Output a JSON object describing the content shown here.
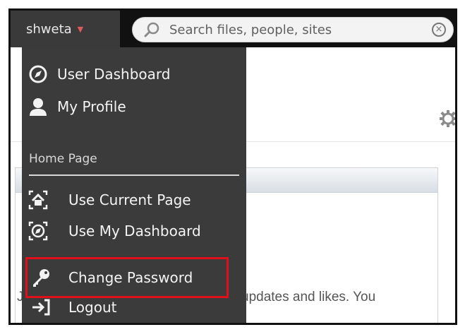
{
  "header": {
    "username": "shweta",
    "search": {
      "placeholder": "Search files, people, sites"
    }
  },
  "user_menu": {
    "items": [
      {
        "label": "User Dashboard",
        "icon": "dashboard-compass-icon"
      },
      {
        "label": "My Profile",
        "icon": "person-icon"
      }
    ],
    "home_page_section": {
      "heading": "Home Page",
      "items": [
        {
          "label": "Use Current Page",
          "icon": "home-current-page-icon"
        },
        {
          "label": "Use My Dashboard",
          "icon": "dashboard-target-icon"
        }
      ]
    },
    "account_items": [
      {
        "label": "Change Password",
        "icon": "key-icon",
        "highlighted": true
      },
      {
        "label": "Logout",
        "icon": "logout-icon"
      }
    ]
  },
  "background_page": {
    "dashlet_text_right": "updates and likes. You",
    "dashlet_text_left": "J"
  },
  "colors": {
    "topbar": "#111111",
    "menu_bg": "#3b3b3b",
    "highlight": "#e0101a"
  }
}
